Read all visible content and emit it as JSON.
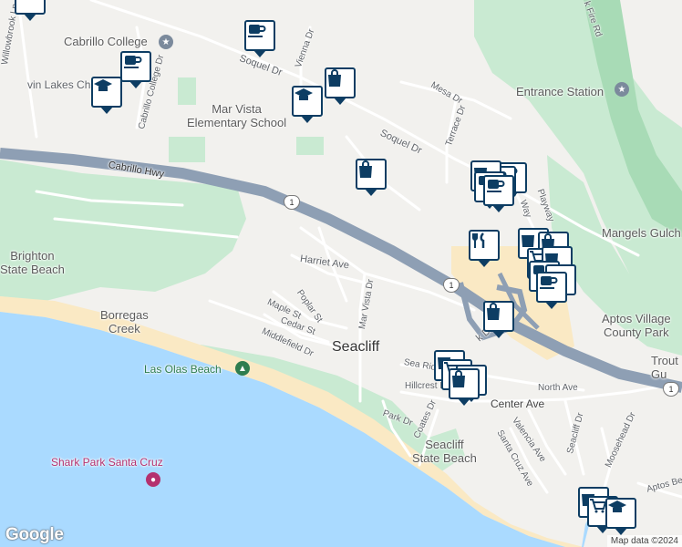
{
  "map": {
    "colors": {
      "water": "#aadaff",
      "land": "#f2f1ee",
      "park": "#c9ead2",
      "forest": "#a8dbb6",
      "highway": "#8e9fb4",
      "beach": "#fae9c4",
      "road": "#ffffff",
      "pin_border": "#0d3d63"
    },
    "labels": {
      "cabrillo_college": "Cabrillo College",
      "twin_lakes_church": "vin Lakes Church",
      "willowbrook": "Willowbrook Ln",
      "cabrillo_college_dr": "Cabrillo College Dr",
      "vienna": "Vienna Dr",
      "soquel_dr_1": "Soquel Dr",
      "soquel_dr_2": "Soquel Dr",
      "mar_vista_elem": "Mar Vista\nElementary School",
      "mesa_dr": "Mesa Dr",
      "terrace_dr": "Terrace Dr",
      "entrance_station": "Entrance Station",
      "park_fire_rd": "k Fire Rd",
      "cabrillo_hwy": "Cabrillo Hwy",
      "broadway": "Way",
      "parkway": "Playway",
      "mangels_gulch": "Mangels Gulch",
      "aptos_village": "Aptos Village\nCounty Park",
      "brighton": "Brighton\nState Beach",
      "harriet": "Harriet Ave",
      "borregas": "Borregas\nCreek",
      "poplar": "Poplar St",
      "maple": "Maple St",
      "mar_vista_dr": "Mar Vista Dr",
      "cedar": "Cedar St",
      "middlefield": "Middlefield Dr",
      "seacliff": "Seacliff",
      "las_olas": "Las Olas Beach",
      "sea_ridge": "Sea Rid",
      "park_dr_ne": "k Dr",
      "hillcrest": "Hillcrest D",
      "north_ave": "North Ave",
      "center_ave": "Center Ave",
      "trout": "Trout\nGu",
      "park_dr": "Park Dr",
      "coates": "Coates Dr",
      "valencia": "Valencia Ave",
      "santa_cruz_ave": "Santa Cruz Ave",
      "seacliff_dr": "Seacliff Dr",
      "seacliff_sb": "Seacliff\nState Beach",
      "moosehead": "Moosehead Dr",
      "aptos_beach": "Aptos Be",
      "shark_park": "Shark Park Santa Cruz"
    },
    "highway_shields": [
      "1",
      "1",
      "1"
    ],
    "attribution": "Map data ©2024",
    "logo": "Google"
  }
}
